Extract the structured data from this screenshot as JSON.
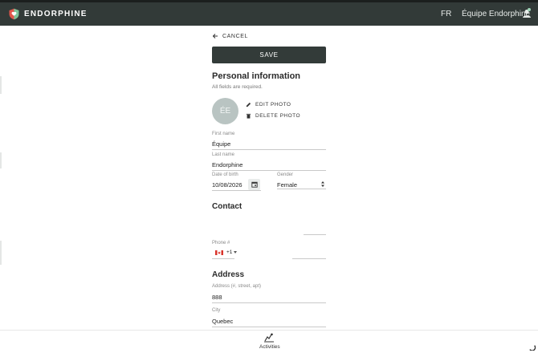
{
  "header": {
    "brand": "ENDORPHINE",
    "language": "FR",
    "user_name": "Équipe Endorphine"
  },
  "actions": {
    "cancel_label": "CANCEL",
    "save_label": "SAVE"
  },
  "personal": {
    "title": "Personal information",
    "required_note": "All fields are required.",
    "avatar_initials": "ÉE",
    "edit_photo": "EDIT PHOTO",
    "delete_photo": "DELETE PHOTO",
    "first_name_label": "First name",
    "first_name_value": "Équipe",
    "last_name_label": "Last name",
    "last_name_value": "Endorphine",
    "dob_label": "Date of birth",
    "dob_value": "10/08/2026",
    "gender_label": "Gender",
    "gender_value": "Female"
  },
  "contact": {
    "title": "Contact",
    "phone_label": "Phone #",
    "dial_code": "+1"
  },
  "address": {
    "title": "Address",
    "street_label": "Address (#, street, apt)",
    "street_value": "888",
    "city_label": "City",
    "city_value": "Quebec"
  },
  "bottom_nav": {
    "activities_label": "Activities"
  },
  "colors": {
    "header_bg": "#323a38",
    "button_bg": "#333b39",
    "avatar_bg": "#b9c4c2",
    "logo_red": "#e0564b",
    "logo_green": "#7cc49a"
  }
}
